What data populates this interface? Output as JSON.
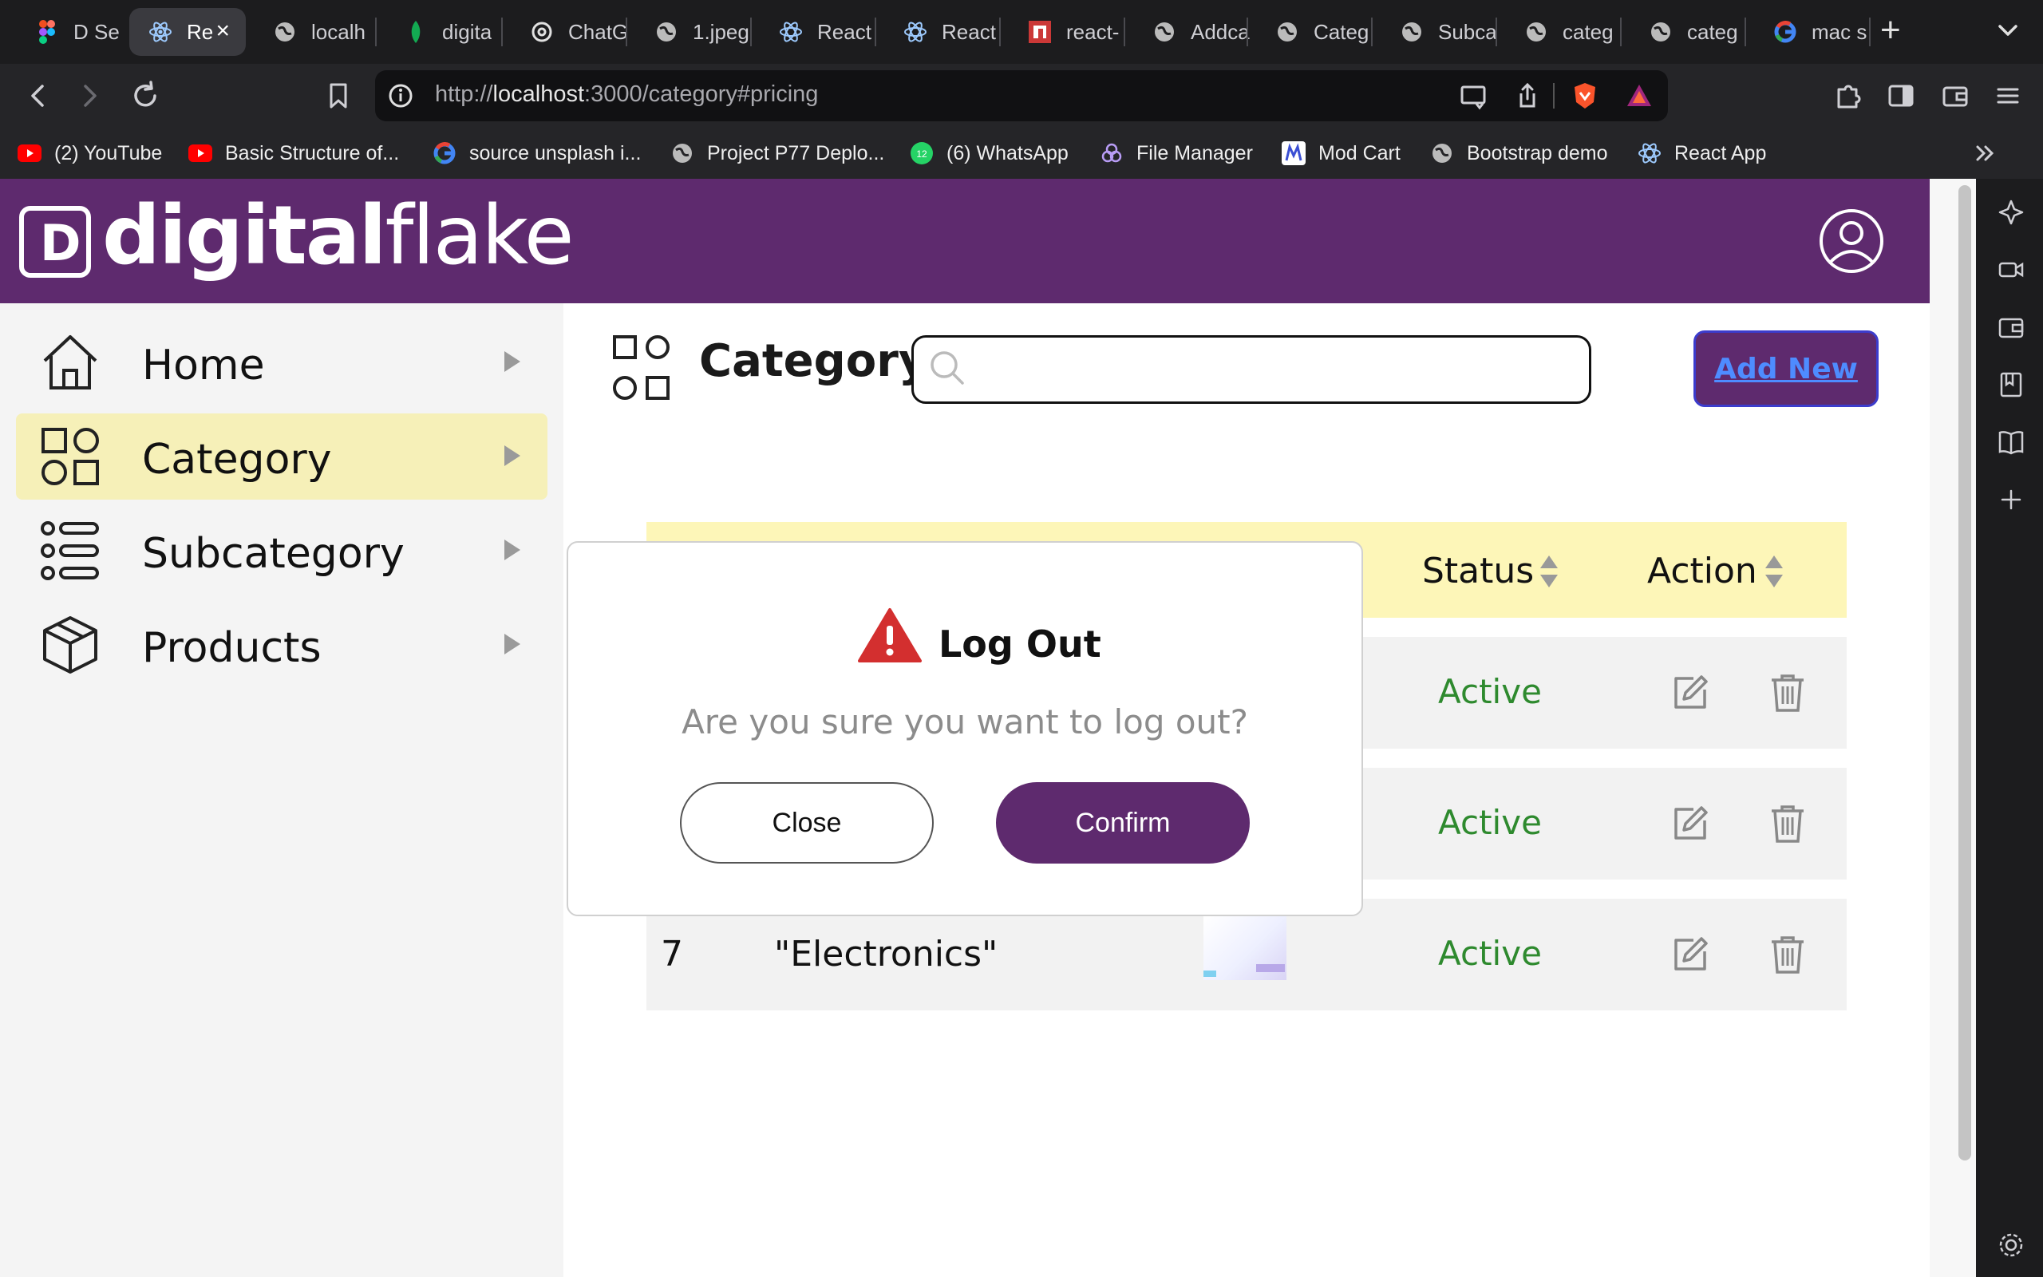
{
  "browser": {
    "tabs": [
      {
        "title": "D Set",
        "icon": "figma-icon"
      },
      {
        "title": "Re",
        "icon": "react-icon",
        "active": true
      },
      {
        "title": "localh",
        "icon": "globe-icon"
      },
      {
        "title": "digita",
        "icon": "mongodb-leaf-icon"
      },
      {
        "title": "ChatG",
        "icon": "chatgpt-icon"
      },
      {
        "title": "1.jpeg",
        "icon": "globe-icon"
      },
      {
        "title": "React",
        "icon": "react-icon"
      },
      {
        "title": "React",
        "icon": "react-icon"
      },
      {
        "title": "react-",
        "icon": "npm-icon"
      },
      {
        "title": "Addca",
        "icon": "globe-icon"
      },
      {
        "title": "Categ",
        "icon": "globe-icon"
      },
      {
        "title": "Subca",
        "icon": "globe-icon"
      },
      {
        "title": "categ",
        "icon": "globe-icon"
      },
      {
        "title": "categ",
        "icon": "globe-icon"
      },
      {
        "title": "mac s",
        "icon": "google-icon"
      }
    ],
    "url_prefix": "http://",
    "url_host": "localhost",
    "url_rest": ":3000/category#pricing",
    "bookmarks": [
      {
        "label": "(2) YouTube",
        "icon": "youtube-icon"
      },
      {
        "label": "Basic Structure of...",
        "icon": "youtube-icon"
      },
      {
        "label": "source unsplash i...",
        "icon": "google-icon"
      },
      {
        "label": "Project P77 Deplo...",
        "icon": "globe-icon"
      },
      {
        "label": "(6) WhatsApp",
        "icon": "whatsapp-icon"
      },
      {
        "label": "File Manager",
        "icon": "file-manager-icon"
      },
      {
        "label": "Mod Cart",
        "icon": "mod-cart-icon"
      },
      {
        "label": "Bootstrap demo",
        "icon": "globe-icon"
      },
      {
        "label": "React App",
        "icon": "react-icon"
      }
    ],
    "whatsapp_badge": "12"
  },
  "app": {
    "logo_bold": "digital",
    "logo_light": "flake",
    "logo_mark": "D",
    "colors": {
      "brand": "#5e2a6e",
      "active_nav": "#f6f0b8",
      "table_head": "#fdf6b8",
      "status_active": "#2e8a2e",
      "danger": "#d32f2f"
    },
    "sidebar": {
      "items": [
        {
          "label": "Home",
          "icon": "home-icon"
        },
        {
          "label": "Category",
          "icon": "category-grid-icon",
          "active": true
        },
        {
          "label": "Subcategory",
          "icon": "list-icon"
        },
        {
          "label": "Products",
          "icon": "box-icon"
        }
      ]
    },
    "page_title": "Category",
    "search_placeholder": "",
    "add_new_label": "Add New",
    "table": {
      "headers": {
        "status": "Status",
        "action": "Action"
      },
      "rows": [
        {
          "id": "",
          "name": "",
          "status": "Active"
        },
        {
          "id": "",
          "name": "",
          "status": "Active"
        },
        {
          "id": "7",
          "name": "\"Electronics\"",
          "status": "Active"
        }
      ]
    },
    "modal": {
      "title": "Log Out",
      "message": "Are you sure you want to log out?",
      "close_label": "Close",
      "confirm_label": "Confirm"
    }
  }
}
